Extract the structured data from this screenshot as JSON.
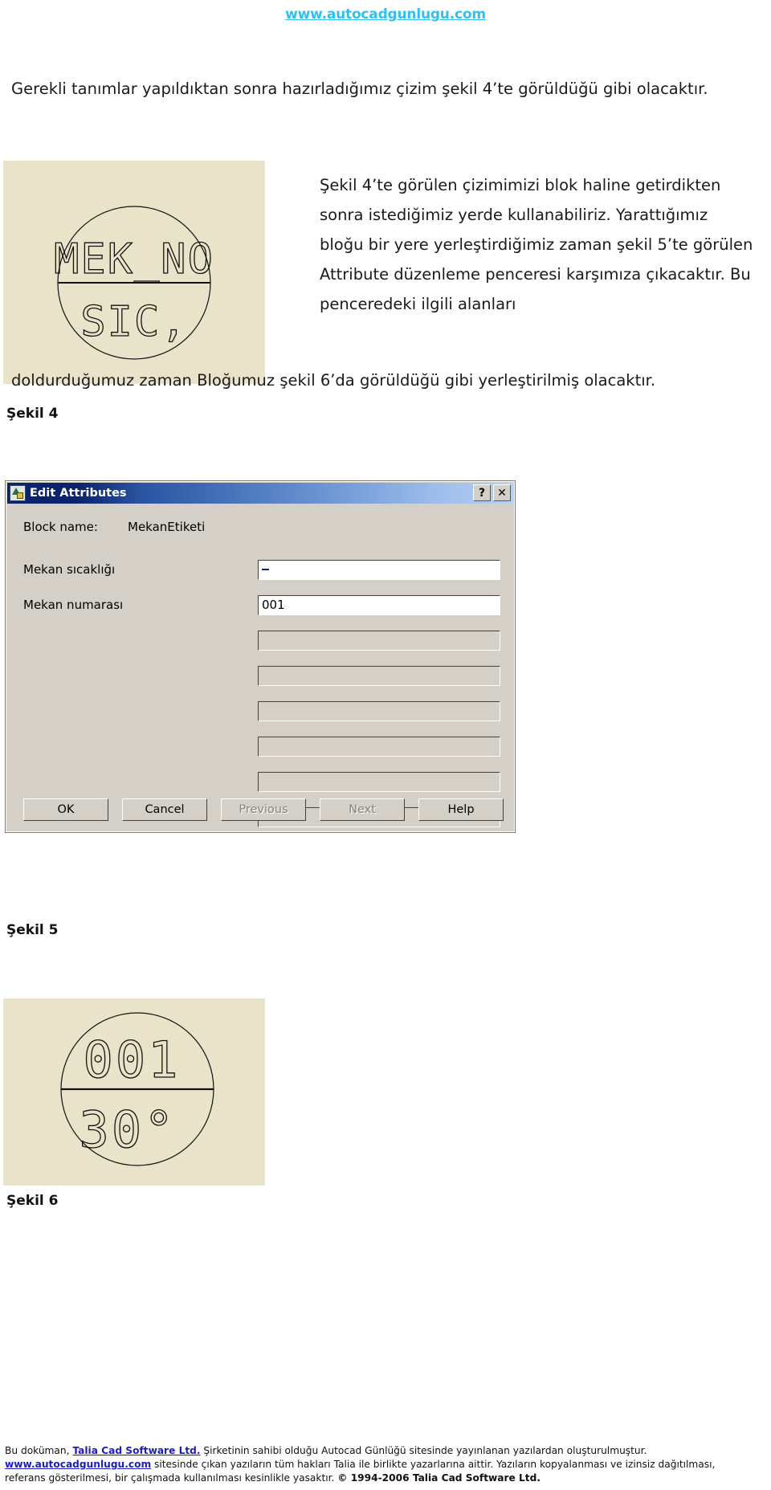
{
  "header": {
    "site_link": "www.autocadgunlugu.com"
  },
  "body": {
    "para_top": "Gerekli tanımlar yapıldıktan sonra hazırladığımız çizim şekil 4’te görüldüğü gibi olacaktır.",
    "para_right": "Şekil 4’te görülen çizimimizi blok haline getirdikten sonra istediğimiz yerde kullanabiliriz. Yarattığımız bloğu bir yere yerleştirdiğimiz zaman şekil 5’te görülen Attribute düzenleme penceresi karşımıza çıkacaktır. Bu penceredeki ilgili alanları",
    "para_mid": "doldurduğumuz zaman Bloğumuz şekil 6’da görüldüğü gibi yerleştirilmiş olacaktır."
  },
  "figures": {
    "sekil4_caption": "Şekil 4",
    "sekil5_caption": "Şekil 5",
    "sekil6_caption": "Şekil 6",
    "sekil4": {
      "top_text": "MEK_NO",
      "bottom_text": "SIC,"
    },
    "sekil6": {
      "top_text": "001",
      "bottom_text": "30°"
    }
  },
  "dialog": {
    "title": "Edit Attributes",
    "title_buttons": {
      "help": "?",
      "close": "✕"
    },
    "block_name_label": "Block name:",
    "block_name_value": "MekanEtiketi",
    "attributes": [
      {
        "label": "Mekan sıcaklığı",
        "value": "",
        "selected": true
      },
      {
        "label": "Mekan numarası",
        "value": "001",
        "selected": false
      },
      {
        "label": "",
        "value": "",
        "selected": false
      },
      {
        "label": "",
        "value": "",
        "selected": false
      },
      {
        "label": "",
        "value": "",
        "selected": false
      },
      {
        "label": "",
        "value": "",
        "selected": false
      },
      {
        "label": "",
        "value": "",
        "selected": false
      },
      {
        "label": "",
        "value": "",
        "selected": false
      }
    ],
    "buttons": [
      {
        "label": "OK",
        "disabled": false
      },
      {
        "label": "Cancel",
        "disabled": false
      },
      {
        "label": "Previous",
        "disabled": true
      },
      {
        "label": "Next",
        "disabled": true
      },
      {
        "label": "Help",
        "disabled": false
      }
    ]
  },
  "footer": {
    "line1_a": "Bu doküman, ",
    "line1_link": "Talia Cad Software Ltd.",
    "line1_b": " Şirketinin sahibi olduğu  Autocad Günlüğü sitesinde yayınlanan yazılardan oluşturulmuştur.",
    "line2_link": "www.autocadgunlugu.com",
    "line2_b": " sitesinde çıkan yazıların tüm hakları Talia ile birlikte yazarlarına aittir. Yazıların kopyalanması ve izinsiz dağıtılması,",
    "line3_a": "referans gösterilmesi, bir çalışmada kullanılması kesinlikle yasaktır. ",
    "line3_copy": "© 1994-2006 Talia Cad Software Ltd."
  },
  "colors": {
    "link": "#2fc0ee",
    "cad_bg": "#e9e4c9",
    "dialog_face": "#d4d0c8",
    "title_start": "#0a246a",
    "selection": "#0a246a",
    "footer_link": "#1d1dbf"
  }
}
